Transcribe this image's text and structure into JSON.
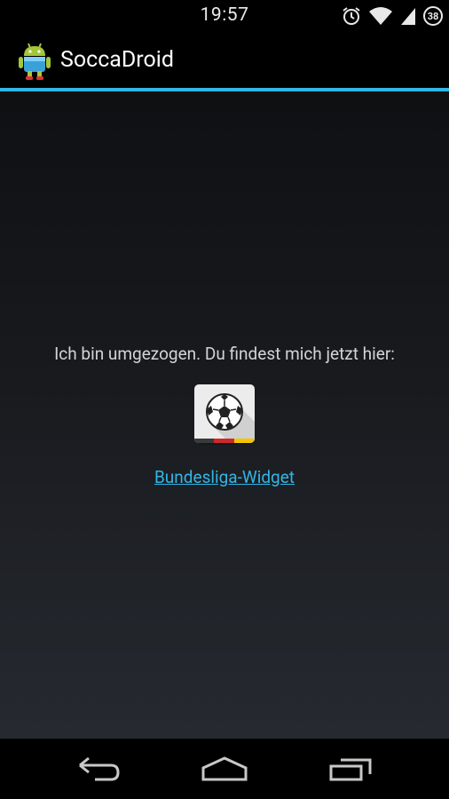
{
  "status_bar": {
    "time": "19:57",
    "battery_level": "38",
    "icons": [
      "alarm-icon",
      "wifi-icon",
      "signal-icon",
      "battery-icon"
    ]
  },
  "action_bar": {
    "app_title": "SoccaDroid",
    "app_icon": "android-soccer-icon"
  },
  "main": {
    "message": "Ich bin umgezogen. Du findest mich jetzt hier:",
    "widget_icon": "soccer-ball-icon",
    "link_label": "Bundesliga-Widget"
  },
  "nav_bar": {
    "buttons": [
      "back-icon",
      "home-icon",
      "recent-apps-icon"
    ]
  },
  "colors": {
    "accent": "#33b5e5",
    "background_top": "#0f1012",
    "background_bottom": "#262a30",
    "text": "#d4d4d4"
  }
}
